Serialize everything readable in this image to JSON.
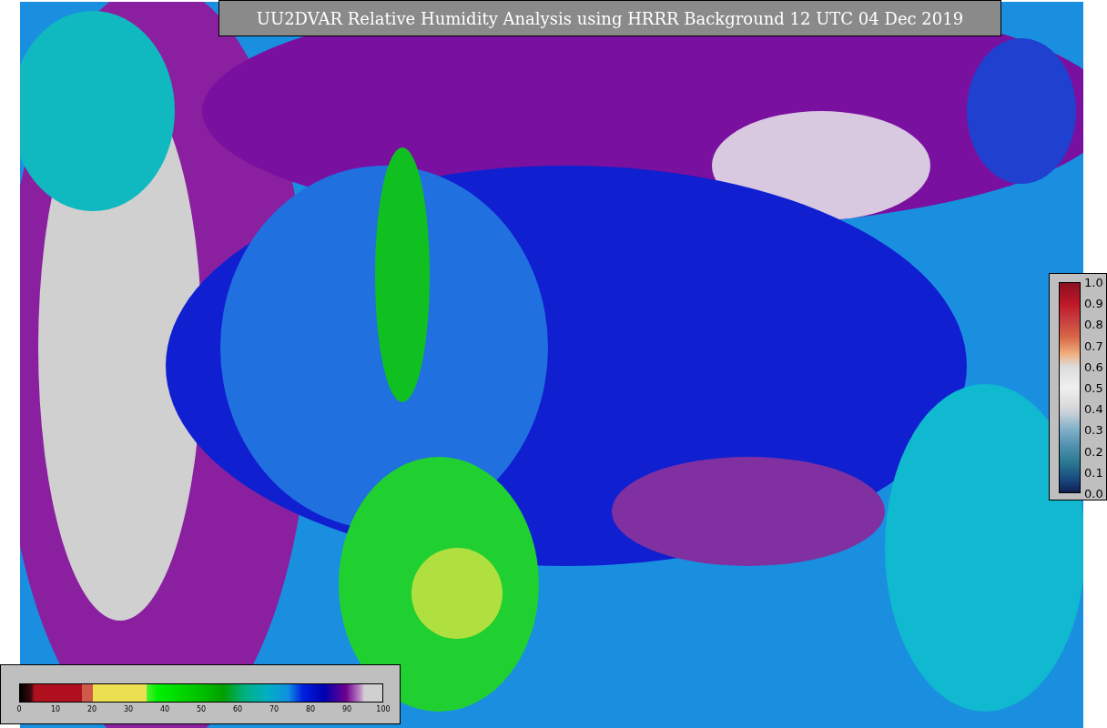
{
  "title": "UU2DVAR Relative Humidity Analysis using HRRR Background 12 UTC 04 Dec 2019",
  "humidity_colorbar": {
    "ticks": [
      "0",
      "10",
      "20",
      "30",
      "40",
      "50",
      "60",
      "70",
      "80",
      "90",
      "100"
    ]
  },
  "observation_colorbar": {
    "ticks": [
      "1.0",
      "0.9",
      "0.8",
      "0.7",
      "0.6",
      "0.5",
      "0.4",
      "0.3",
      "0.2",
      "0.1",
      "0.0"
    ]
  }
}
